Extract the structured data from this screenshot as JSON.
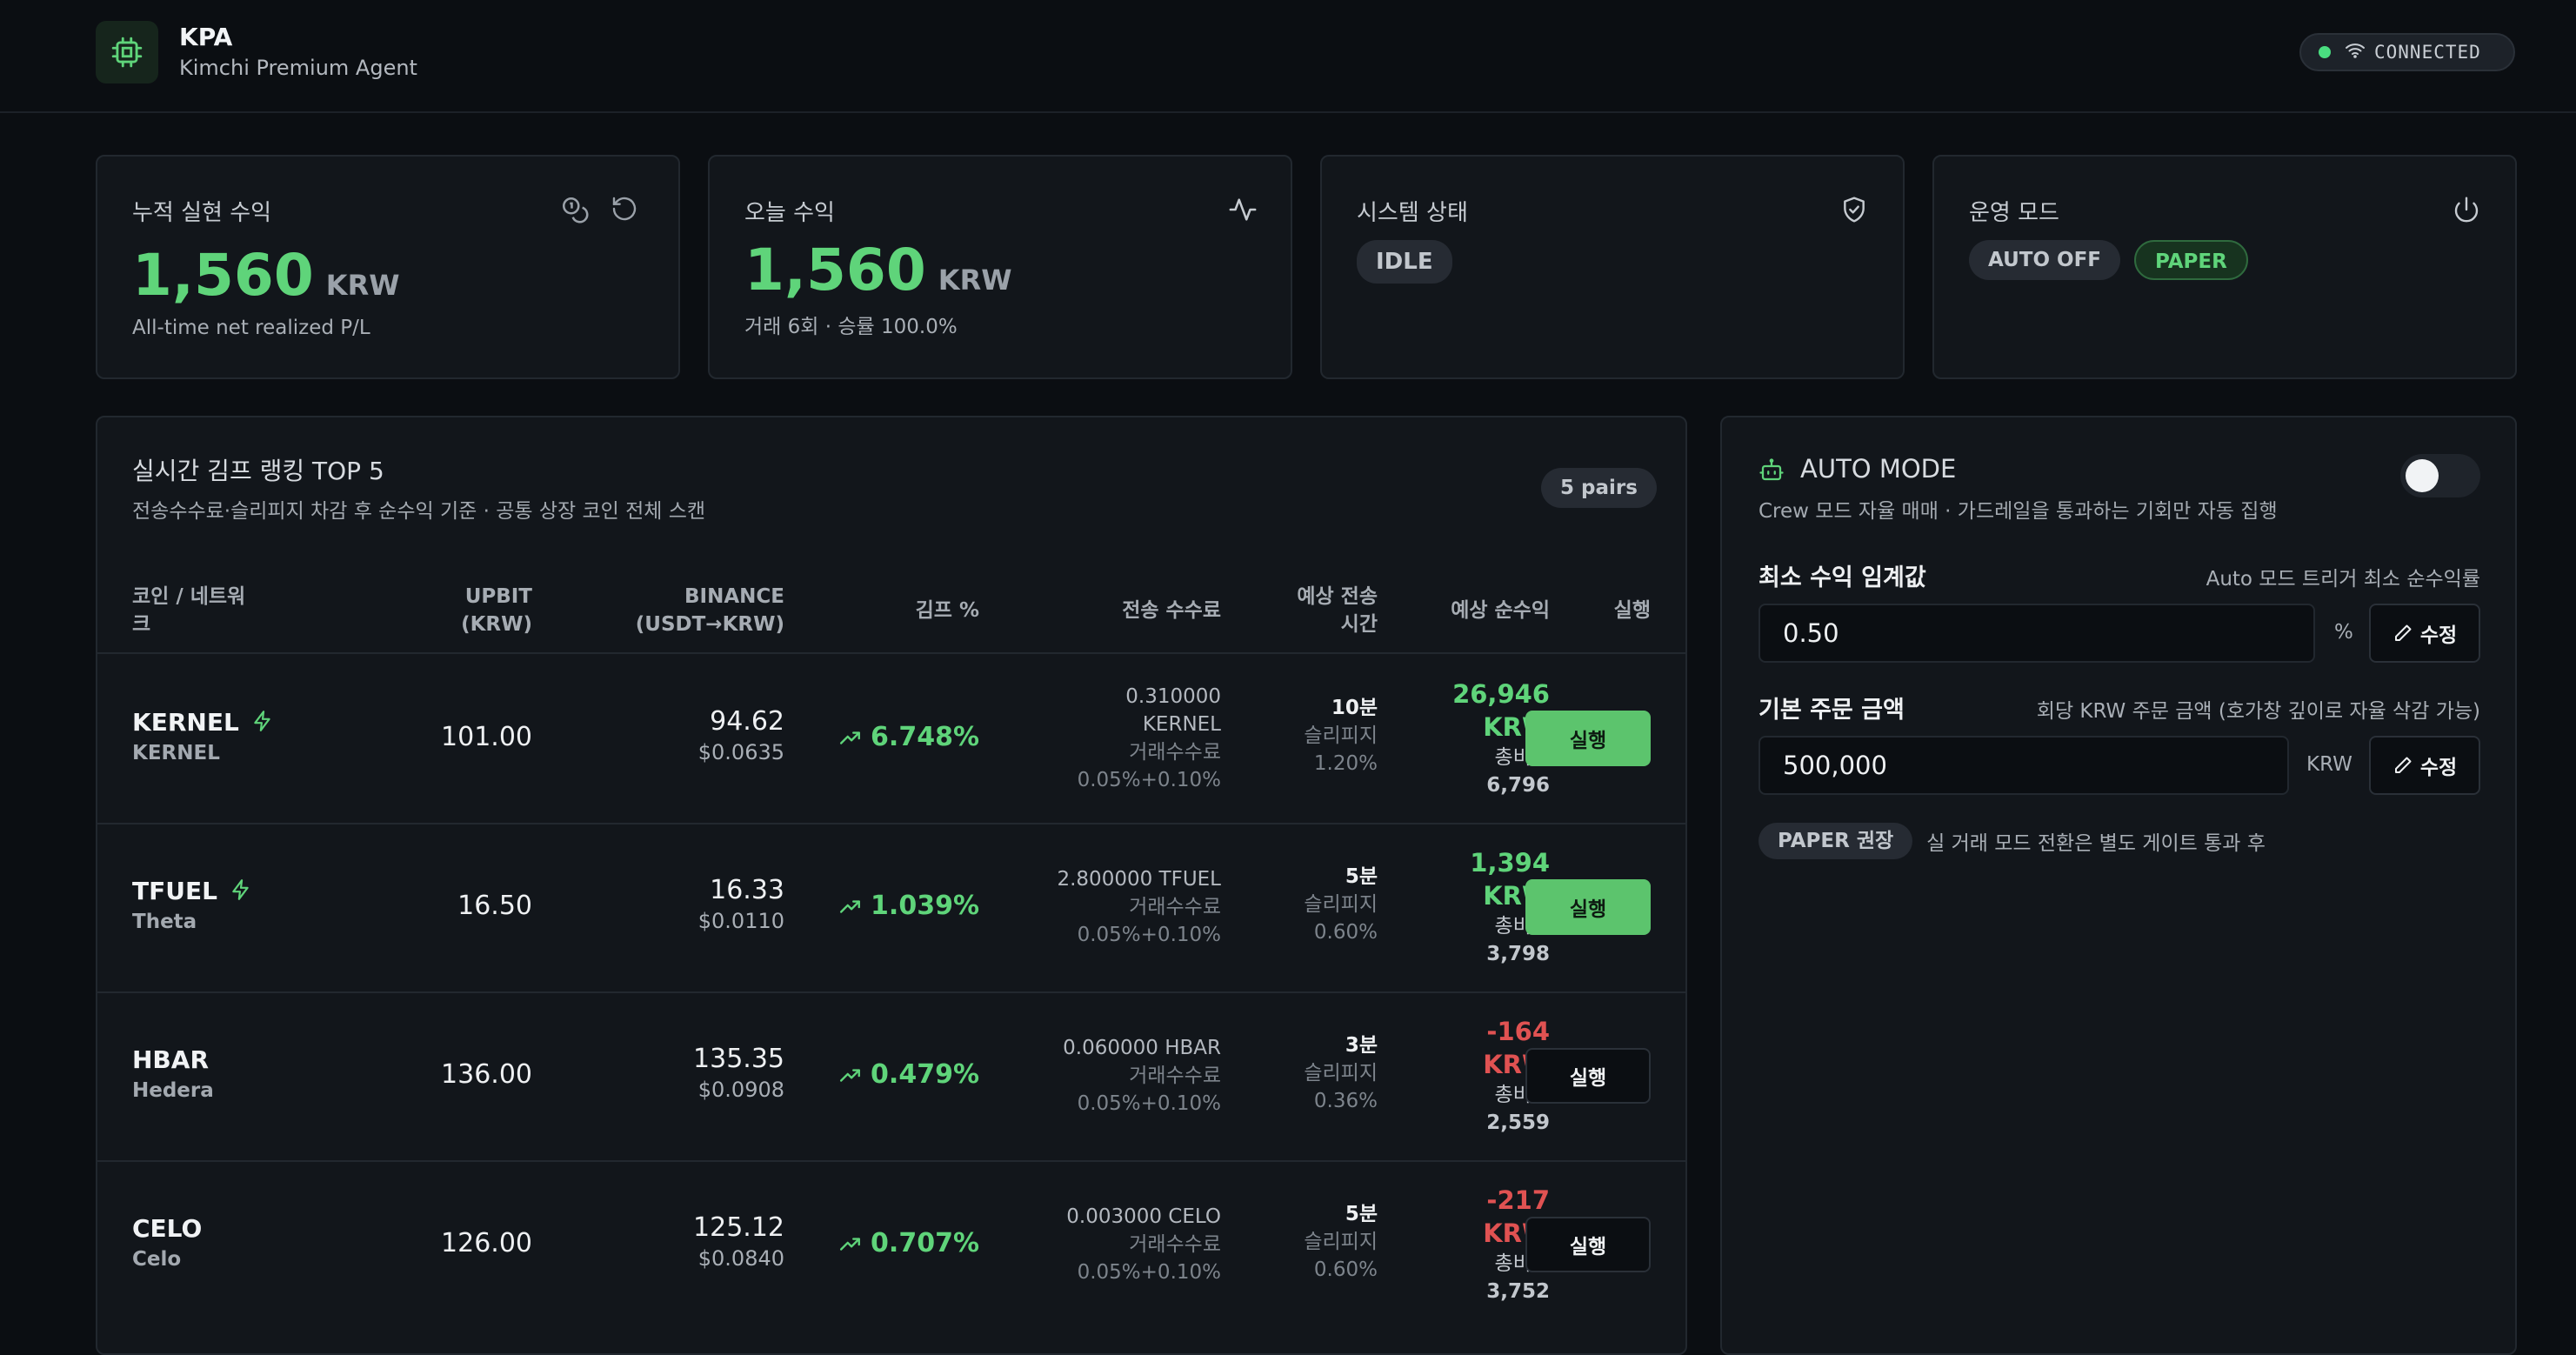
{
  "header": {
    "title": "KPA",
    "subtitle": "Kimchi Premium Agent",
    "status": "CONNECTED",
    "status_color": "#4ade80"
  },
  "cards": {
    "realized": {
      "title": "누적 실현 수익",
      "value": "1,560",
      "unit": "KRW",
      "sub": "All-time net realized P/L"
    },
    "today": {
      "title": "오늘 수익",
      "value": "1,560",
      "unit": "KRW",
      "sub": "거래 6회 · 승률 100.0%"
    },
    "system": {
      "title": "시스템 상태",
      "status": "IDLE"
    },
    "mode": {
      "title": "운영 모드",
      "auto": "AUTO OFF",
      "paper": "PAPER"
    }
  },
  "ranking": {
    "title": "실시간 김프 랭킹 TOP 5",
    "subtitle": "전송수수료·슬리피지 차감 후 순수익 기준 · 공통 상장 코인 전체 스캔",
    "pairs": "5 pairs",
    "headers": {
      "coin_1": "코인 / 네트워",
      "coin_2": "크",
      "upbit_1": "UPBIT",
      "upbit_2": "(KRW)",
      "binance_1": "BINANCE",
      "binance_2": "(USDT→KRW)",
      "gimp": "김프 %",
      "fee": "전송 수수료",
      "time_1": "예상 전송",
      "time_2": "시간",
      "profit": "예상 순수익",
      "exec": "실행"
    },
    "rows": [
      {
        "coin": "KERNEL",
        "network": "KERNEL",
        "fast": true,
        "upbit": "101.00",
        "binance": "94.62",
        "usd": "$0.0635",
        "gimp": "6.748%",
        "fee_lines": [
          "0.310000",
          "KERNEL"
        ],
        "fee_label": "거래수수료",
        "fee_rate": "0.05%+0.10%",
        "time": "10분",
        "slip_label": "슬리피지",
        "slip": "1.20%",
        "profit_lines": [
          "26,946",
          "KRW"
        ],
        "profit_positive": true,
        "cost_label": "총비용",
        "cost": "6,796",
        "exec": "실행",
        "exec_enabled": true
      },
      {
        "coin": "TFUEL",
        "network": "Theta",
        "fast": true,
        "upbit": "16.50",
        "binance": "16.33",
        "usd": "$0.0110",
        "gimp": "1.039%",
        "fee_lines": [
          "2.800000 TFUEL"
        ],
        "fee_label": "거래수수료",
        "fee_rate": "0.05%+0.10%",
        "time": "5분",
        "slip_label": "슬리피지",
        "slip": "0.60%",
        "profit_lines": [
          "1,394",
          "KRW"
        ],
        "profit_positive": true,
        "cost_label": "총비용",
        "cost": "3,798",
        "exec": "실행",
        "exec_enabled": true
      },
      {
        "coin": "HBAR",
        "network": "Hedera",
        "fast": false,
        "upbit": "136.00",
        "binance": "135.35",
        "usd": "$0.0908",
        "gimp": "0.479%",
        "fee_lines": [
          "0.060000 HBAR"
        ],
        "fee_label": "거래수수료",
        "fee_rate": "0.05%+0.10%",
        "time": "3분",
        "slip_label": "슬리피지",
        "slip": "0.36%",
        "profit_lines": [
          "-164",
          "KRW"
        ],
        "profit_positive": false,
        "cost_label": "총비용",
        "cost": "2,559",
        "exec": "실행",
        "exec_enabled": false
      },
      {
        "coin": "CELO",
        "network": "Celo",
        "fast": false,
        "upbit": "126.00",
        "binance": "125.12",
        "usd": "$0.0840",
        "gimp": "0.707%",
        "fee_lines": [
          "0.003000 CELO"
        ],
        "fee_label": "거래수수료",
        "fee_rate": "0.05%+0.10%",
        "time": "5분",
        "slip_label": "슬리피지",
        "slip": "0.60%",
        "profit_lines": [
          "-217",
          "KRW"
        ],
        "profit_positive": false,
        "cost_label": "총비용",
        "cost": "3,752",
        "exec": "실행",
        "exec_enabled": false
      }
    ]
  },
  "auto": {
    "title": "AUTO MODE",
    "subtitle": "Crew 모드 자율 매매 · 가드레일을 통과하는 기회만 자동 집행",
    "enabled": false,
    "threshold": {
      "label": "최소 수익 임계값",
      "hint": "Auto 모드 트리거 최소 순수익률",
      "value": "0.50",
      "unit": "%",
      "edit": "수정"
    },
    "order": {
      "label": "기본 주문 금액",
      "hint": "회당 KRW 주문 금액 (호가창 깊이로 자율 삭감 가능)",
      "value": "500,000",
      "unit": "KRW",
      "edit": "수정"
    },
    "paper_badge": "PAPER 권장",
    "paper_note": "실 거래 모드 전환은 별도 게이트 통과 후"
  }
}
